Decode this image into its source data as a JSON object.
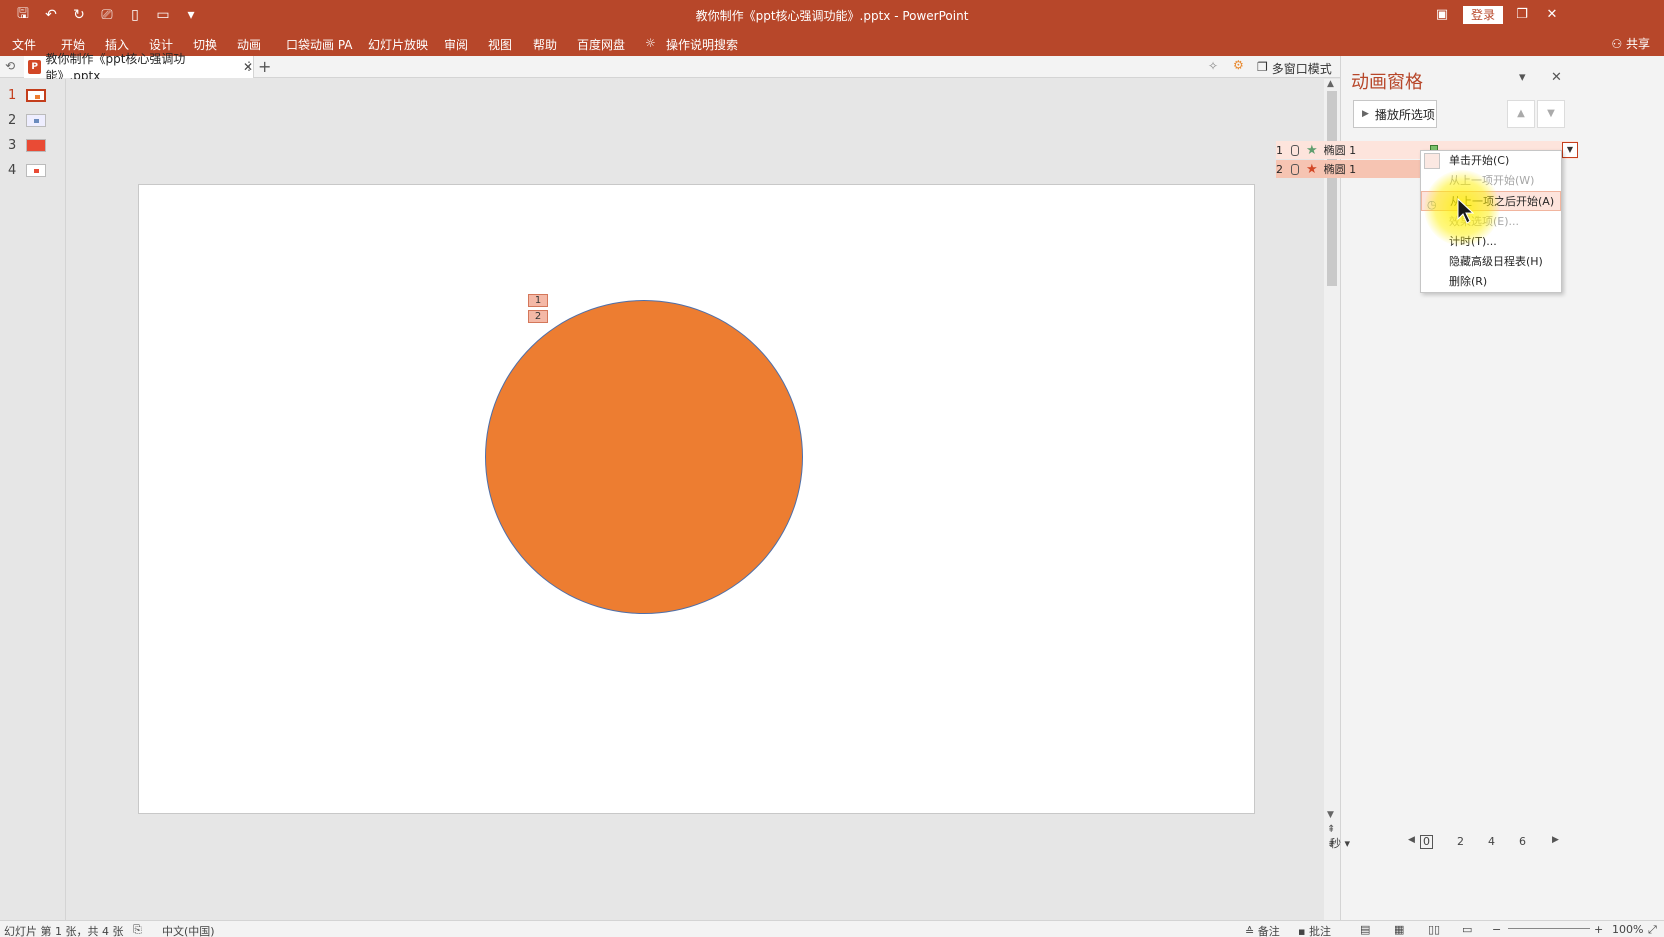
{
  "window": {
    "title": "教你制作《ppt核心强调功能》.pptx  -  PowerPoint",
    "login_label": "登录",
    "share_label": "共享"
  },
  "ribbon": {
    "tabs": [
      "文件",
      "开始",
      "插入",
      "设计",
      "切换",
      "动画",
      "口袋动画 PA",
      "幻灯片放映",
      "审阅",
      "视图",
      "帮助",
      "百度网盘",
      "操作说明搜索"
    ]
  },
  "document_tab": {
    "filename": "教你制作《ppt核心强调功能》.pptx",
    "multiwindow_label": "多窗口模式"
  },
  "thumbnails": [
    {
      "number": "1"
    },
    {
      "number": "2"
    },
    {
      "number": "3"
    },
    {
      "number": "4"
    }
  ],
  "slide": {
    "anim_tags": [
      "1",
      "2"
    ],
    "shape_color": "#ed7d31"
  },
  "animation_pane": {
    "title": "动画窗格",
    "play_button": "播放所选项",
    "rows": [
      {
        "number": "1",
        "name": "椭圆 1",
        "effect_color": "#5f9e6e"
      },
      {
        "number": "2",
        "name": "椭圆 1",
        "effect_color": "#d24726"
      }
    ],
    "context_menu": [
      {
        "label": "单击开始(C)",
        "state": "selected"
      },
      {
        "label": "从上一项开始(W)",
        "state": "disabled"
      },
      {
        "label": "从上一项之后开始(A)",
        "state": "hover"
      },
      {
        "label": "效果选项(E)...",
        "state": "disabled"
      },
      {
        "label": "计时(T)...",
        "state": "normal"
      },
      {
        "label": "隐藏高级日程表(H)",
        "state": "normal"
      },
      {
        "label": "删除(R)",
        "state": "normal"
      }
    ],
    "timeline": {
      "unit_label": "秒",
      "ticks": [
        "0",
        "2",
        "4",
        "6"
      ]
    }
  },
  "statusbar": {
    "slide_info": "幻灯片 第 1 张，共 4 张",
    "language": "中文(中国)",
    "notes": "备注",
    "comments": "批注",
    "zoom": "100%"
  },
  "colors": {
    "accent": "#b7472a",
    "brand_red": "#d24726"
  }
}
